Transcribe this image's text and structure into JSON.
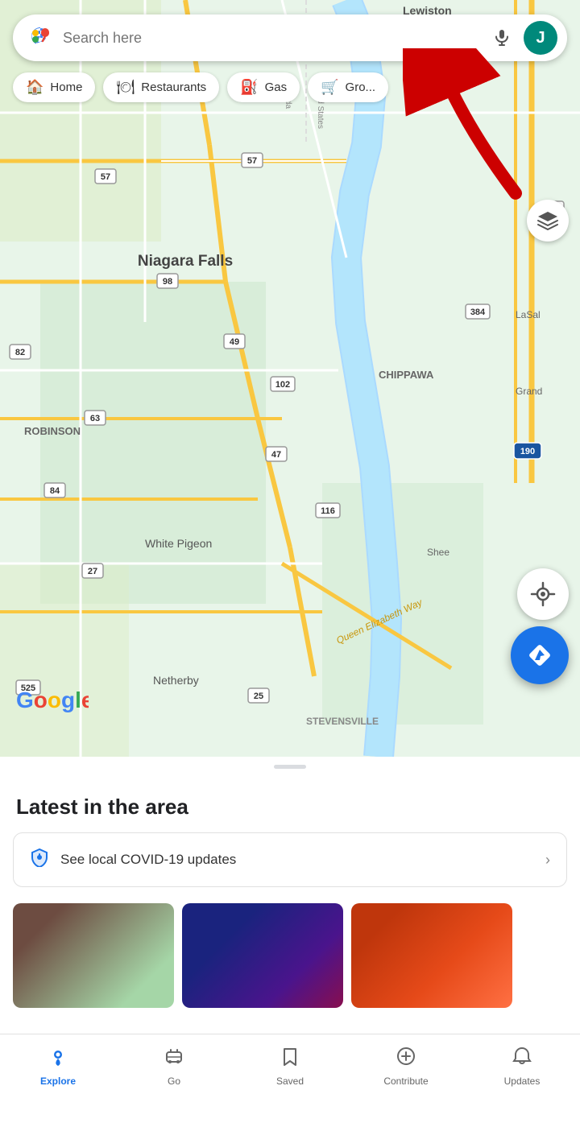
{
  "search": {
    "placeholder": "Search here"
  },
  "profile": {
    "initial": "J",
    "bg_color": "#00897b"
  },
  "categories": [
    {
      "id": "home",
      "label": "Home",
      "icon": "🏠"
    },
    {
      "id": "restaurants",
      "label": "Restaurants",
      "icon": "🍽"
    },
    {
      "id": "gas",
      "label": "Gas",
      "icon": "⛽"
    },
    {
      "id": "groceries",
      "label": "Gro...",
      "icon": "🛒"
    }
  ],
  "map": {
    "city": "Niagara Falls",
    "roads": [
      "57",
      "57",
      "98",
      "49",
      "82",
      "63",
      "47",
      "84",
      "27",
      "116",
      "25",
      "525",
      "182",
      "190",
      "384",
      "102"
    ],
    "areas": [
      "ROBINSON",
      "CHIPPAWA",
      "STEVENSVILLE",
      "White Pigeon",
      "Netherby",
      "LaSal",
      "Grand",
      "Shee"
    ],
    "water_label": "Queen Elizabeth Way"
  },
  "bottom_sheet": {
    "handle_visible": true,
    "section_title": "Latest in the area",
    "covid_card": {
      "text": "See local COVID-19 updates",
      "has_chevron": true
    }
  },
  "bottom_nav": [
    {
      "id": "explore",
      "label": "Explore",
      "icon": "📍",
      "active": true
    },
    {
      "id": "go",
      "label": "Go",
      "icon": "🚌",
      "active": false
    },
    {
      "id": "saved",
      "label": "Saved",
      "icon": "🔖",
      "active": false
    },
    {
      "id": "contribute",
      "label": "Contribute",
      "icon": "⊕",
      "active": false
    },
    {
      "id": "updates",
      "label": "Updates",
      "icon": "🔔",
      "active": false
    }
  ],
  "colors": {
    "accent_blue": "#1a73e8",
    "map_green": "#c8e6c9",
    "map_road_yellow": "#f9c741",
    "map_water": "#aadaff",
    "teal": "#00897b"
  }
}
